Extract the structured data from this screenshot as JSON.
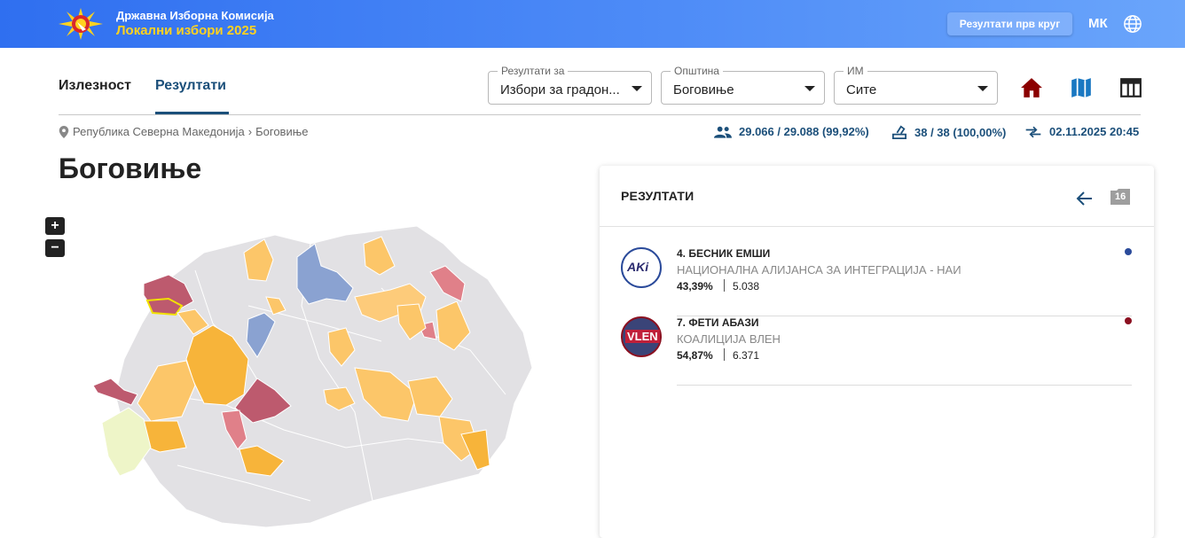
{
  "header": {
    "brand_line1": "Државна Изборна Комисија",
    "brand_line2": "Локални избори 2025",
    "first_round_button": "Резултати прв круг",
    "language": "МК",
    "colors": {
      "bar": "#3b7af3",
      "accent_yellow": "#ffd21f"
    }
  },
  "tabs": [
    {
      "label": "Излезност",
      "active": false
    },
    {
      "label": "Резултати",
      "active": true
    }
  ],
  "filters": {
    "results_for": {
      "label": "Резултати за",
      "value": "Избори за градон..."
    },
    "municipality": {
      "label": "Општина",
      "value": "Боговиње"
    },
    "im": {
      "label": "ИМ",
      "value": "Сите"
    }
  },
  "tools": {
    "home_icon": "home-icon",
    "map_icon": "map-icon",
    "table_icon": "table-icon",
    "home_color": "#8b0000",
    "map_color": "#1a78c2",
    "table_color": "#222222"
  },
  "breadcrumb": {
    "items": [
      "Република Северна Македонија",
      "Боговиње"
    ]
  },
  "stats": {
    "voters": "29.066 / 29.088 (99,92%)",
    "polling_stations": "38 / 38 (100,00%)",
    "updated": "02.11.2025 20:45"
  },
  "page_title": "Боговиње",
  "zoom": {
    "in": "+",
    "out": "−"
  },
  "results_panel": {
    "title": "РЕЗУЛТАТИ",
    "count_badge": "16",
    "candidates": [
      {
        "name": "4. БЕСНИК ЕМШИ",
        "party": "НАЦИОНАЛНА АЛИЈАНСА ЗА ИНТЕГРАЦИЈА - НАИ",
        "percent": "43,39%",
        "votes": "5.038",
        "dot_color": "#2a4a9a",
        "logo_text": "AKi"
      },
      {
        "name": "7. ФЕТИ АБАЗИ",
        "party": "КОАЛИЦИЈА ВЛЕН",
        "percent": "54,87%",
        "votes": "6.371",
        "dot_color": "#8b1020",
        "logo_text": "VLEN"
      }
    ]
  }
}
